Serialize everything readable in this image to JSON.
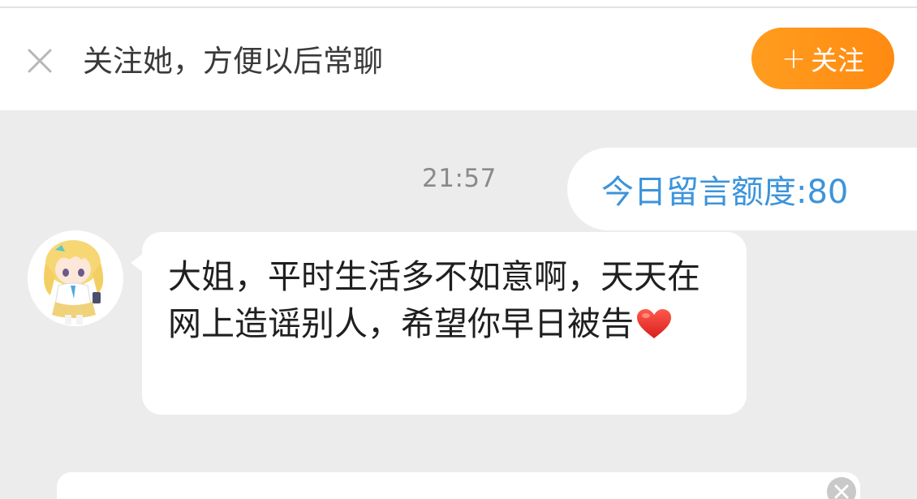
{
  "follow_bar": {
    "close_icon": "close-icon",
    "prompt": "关注她，方便以后常聊",
    "follow_button": {
      "icon": "+",
      "label": "关注",
      "color": "#ff9417"
    }
  },
  "chat": {
    "time": "21:57",
    "quota_bubble": {
      "text": "今日留言额度:80",
      "color": "#3d94db"
    },
    "incoming_message": {
      "avatar": "anime-girl-avatar",
      "text": "大姐，平时生活多不如意啊，天天在网上造谣别人，希望你早日被告",
      "emoji": "heart-icon"
    }
  },
  "input": {
    "clear_icon": "clear-icon"
  }
}
